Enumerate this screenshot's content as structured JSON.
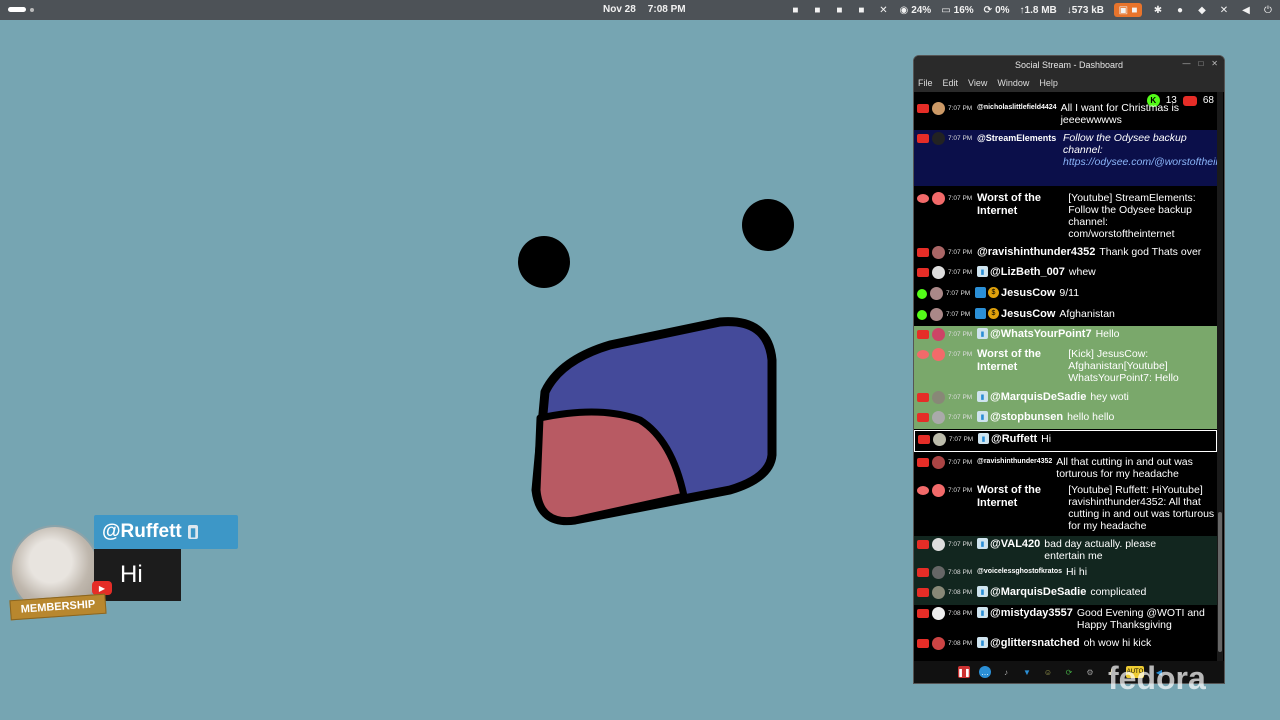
{
  "topbar": {
    "date": "Nov 28",
    "time": "7:08 PM",
    "cpu": "24%",
    "mem": "16%",
    "swap": "0%",
    "net_up": "↑1.8 MB",
    "net_down": "↓573 kB"
  },
  "overlay": {
    "username": "@Ruffett",
    "message": "Hi",
    "badge_label": "MEMBERSHIP"
  },
  "window": {
    "title": "Social Stream - Dashboard",
    "menu": [
      "File",
      "Edit",
      "View",
      "Window",
      "Help"
    ],
    "kick_viewers": "13",
    "youtube_viewers": "68"
  },
  "feed": [
    {
      "src": "yt",
      "time": "7:07 PM",
      "user": "@nicholaslittlefield4424",
      "msg": "All I want for Christmas is jeeeewwwws",
      "style": "small"
    },
    {
      "src": "yt",
      "time": "7:07 PM",
      "user": "@StreamElements",
      "msg": "Follow the Odysee backup channel:",
      "link": "https://odysee.com/@worstoftheinternet",
      "style": "navy"
    },
    {
      "src": "woti",
      "time": "7:07 PM",
      "user": "Worst of the Internet",
      "msg": "[Youtube] StreamElements: Follow the Odysee backup channel: com/worstoftheinternet"
    },
    {
      "src": "yt",
      "time": "7:07 PM",
      "user": "@ravishinthunder4352",
      "msg": "Thank god Thats over"
    },
    {
      "src": "yt",
      "time": "7:07 PM",
      "user": "@LizBeth_007",
      "msg": "whew"
    },
    {
      "src": "kick",
      "time": "7:07 PM",
      "user": "JesusCow",
      "msg": "9/11"
    },
    {
      "src": "kick",
      "time": "7:07 PM",
      "user": "JesusCow",
      "msg": "Afghanistan"
    },
    {
      "src": "yt",
      "time": "7:07 PM",
      "user": "@WhatsYourPoint7",
      "msg": "Hello",
      "style": "green"
    },
    {
      "src": "woti",
      "time": "7:07 PM",
      "user": "Worst of the Internet",
      "msg": "[Kick] JesusCow: Afghanistan[Youtube] WhatsYourPoint7: Hello",
      "style": "green"
    },
    {
      "src": "yt",
      "time": "7:07 PM",
      "user": "@MarquisDeSadie",
      "msg": "hey woti",
      "style": "green"
    },
    {
      "src": "yt",
      "time": "7:07 PM",
      "user": "@stopbunsen",
      "msg": "hello hello",
      "style": "green"
    },
    {
      "src": "yt",
      "time": "7:07 PM",
      "user": "@Ruffett",
      "msg": "Hi",
      "style": "green-sel"
    },
    {
      "src": "yt",
      "time": "7:07 PM",
      "user": "@ravishinthunder4352",
      "msg": "All that cutting in and out was torturous for my headache",
      "style": "small"
    },
    {
      "src": "woti",
      "time": "7:07 PM",
      "user": "Worst of the Internet",
      "msg": "[Youtube] Ruffett: HiYoutube] ravishinthunder4352: All that cutting in and out was torturous for my headache"
    },
    {
      "src": "yt",
      "time": "7:07 PM",
      "user": "@VAL420",
      "msg": "bad day actually. please entertain me",
      "style": "darkgreen"
    },
    {
      "src": "yt",
      "time": "7:08 PM",
      "user": "@voicelessghostofkratos",
      "msg": "Hi hi",
      "style": "darkgreen-small"
    },
    {
      "src": "yt",
      "time": "7:08 PM",
      "user": "@MarquisDeSadie",
      "msg": "complicated",
      "style": "darkgreen"
    },
    {
      "src": "yt",
      "time": "7:08 PM",
      "user": "@mistyday3557",
      "msg": "Good Evening @WOTI and Happy Thanksgiving"
    },
    {
      "src": "yt",
      "time": "7:08 PM",
      "user": "@glittersnatched",
      "msg": "oh wow hi kick"
    }
  ],
  "watermark": "fedora"
}
